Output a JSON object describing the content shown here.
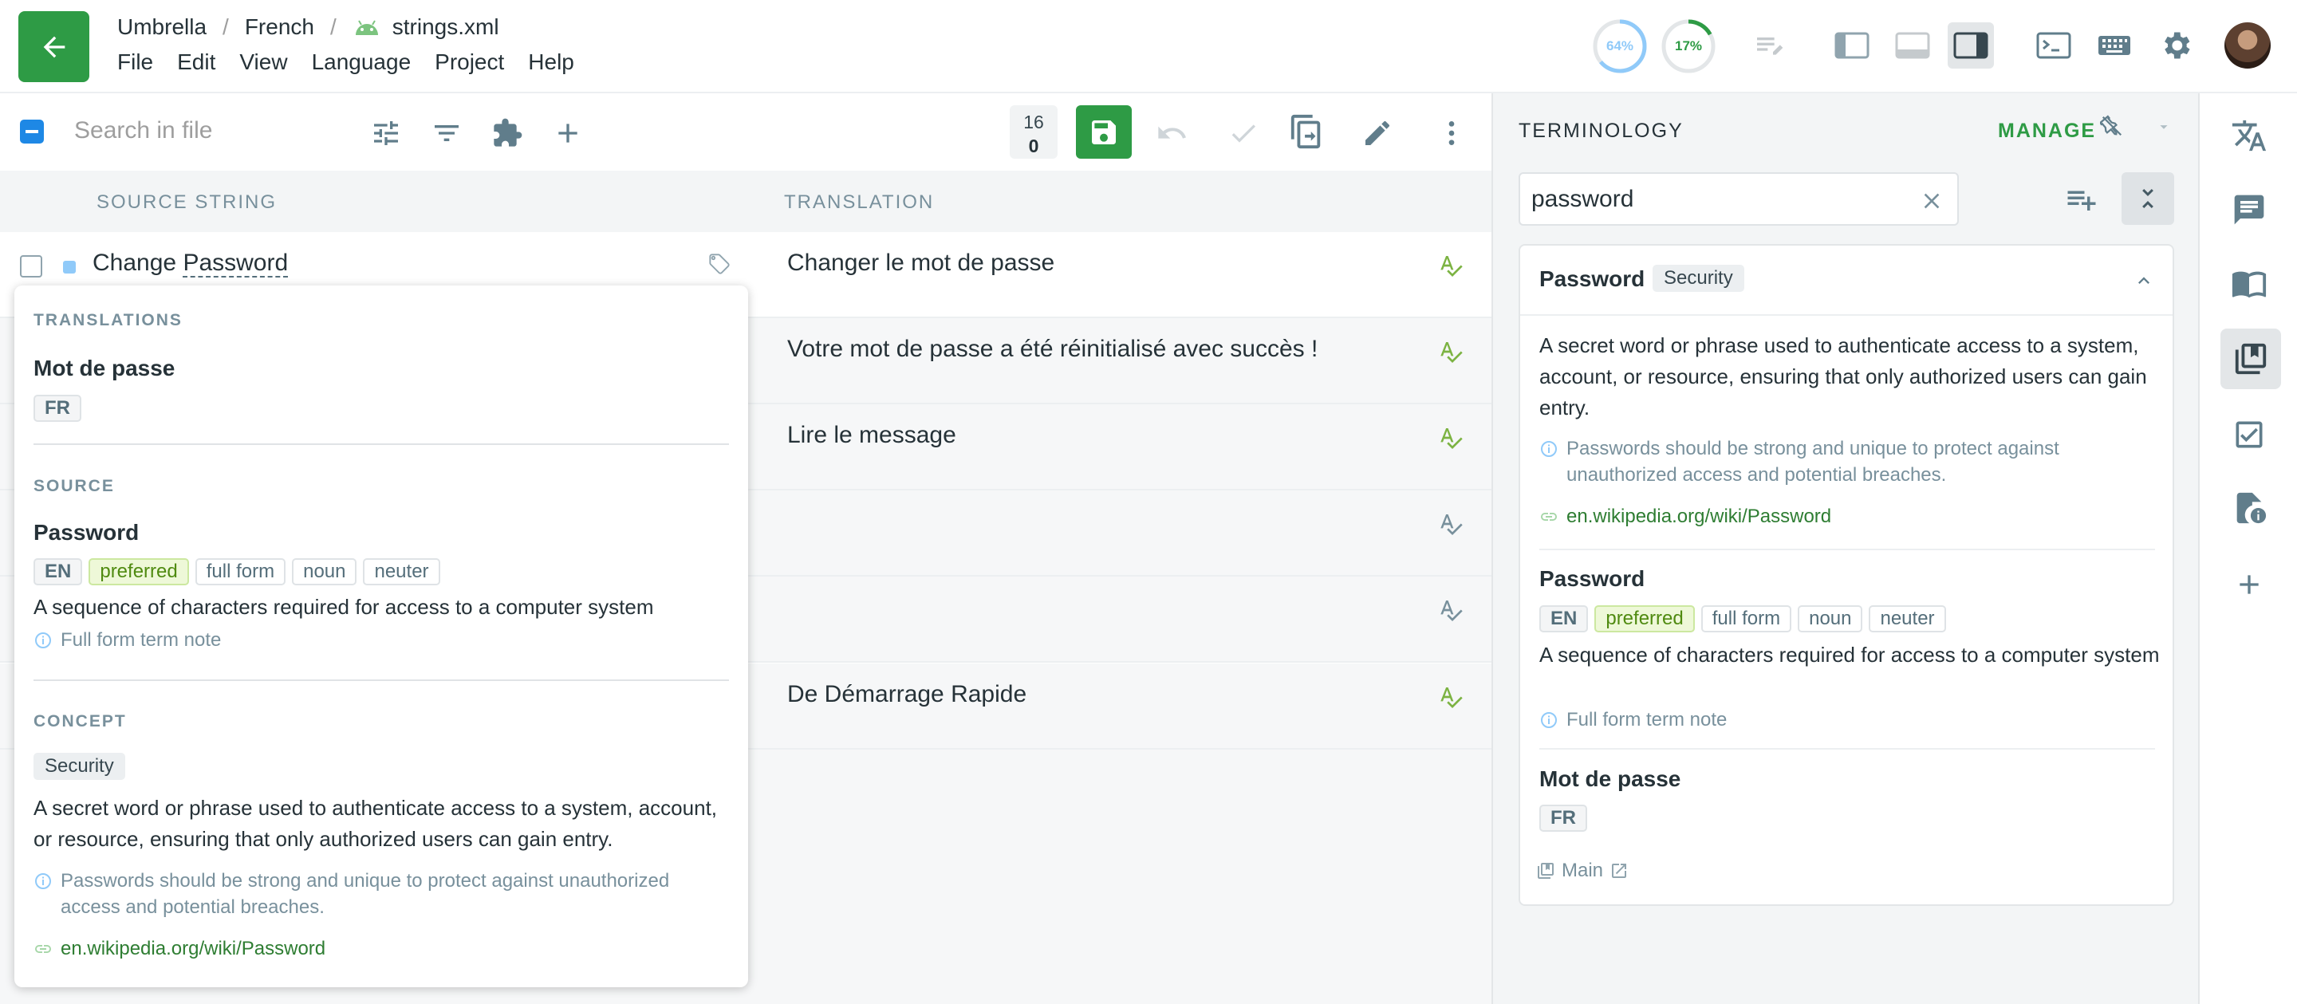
{
  "header": {
    "breadcrumb": {
      "project": "Umbrella",
      "language": "French",
      "file": "strings.xml",
      "separator": "/"
    },
    "menu": [
      "File",
      "Edit",
      "View",
      "Language",
      "Project",
      "Help"
    ],
    "progress": [
      {
        "value": "64%",
        "fraction": 0.64,
        "color": "#90caf9"
      },
      {
        "value": "17%",
        "fraction": 0.17,
        "color": "#2e9b45"
      }
    ]
  },
  "toolbar": {
    "search_placeholder": "Search in file",
    "counter_top": "16",
    "counter_bottom": "0"
  },
  "table": {
    "source_header": "SOURCE STRING",
    "translation_header": "TRANSLATION",
    "rows": [
      {
        "source_prefix": "Change ",
        "source_term": "Password",
        "translation": "Changer le mot de passe"
      },
      {
        "translation": "Votre mot de passe a été réinitialisé avec succès !"
      },
      {
        "translation": "Lire le message"
      },
      {
        "translation": ""
      },
      {
        "translation": ""
      },
      {
        "translation": "De Démarrage Rapide"
      }
    ]
  },
  "popover": {
    "translations_label": "TRANSLATIONS",
    "translation_term": "Mot de passe",
    "translation_lang": "FR",
    "source_label": "SOURCE",
    "source_term": "Password",
    "source_chips": [
      "EN",
      "preferred",
      "full form",
      "noun",
      "neuter"
    ],
    "source_definition": "A sequence of characters required for access to a computer system",
    "source_note": "Full form term note",
    "concept_label": "CONCEPT",
    "concept_chip": "Security",
    "concept_definition": "A secret word or phrase used to authenticate access to a system, account, or resource, ensuring that only authorized users can gain entry.",
    "concept_note": "Passwords should be strong and unique to protect against unauthorized access and potential breaches.",
    "concept_link": "en.wikipedia.org/wiki/Password"
  },
  "terminology": {
    "title": "TERMINOLOGY",
    "manage": "MANAGE",
    "search_value": "password",
    "card": {
      "name": "Password",
      "chip": "Security",
      "definition": "A secret word or phrase used to authenticate access to a system, account, or resource, ensuring that only authorized users can gain entry.",
      "note": "Passwords should be strong and unique to protect against unauthorized access and potential breaches.",
      "link": "en.wikipedia.org/wiki/Password",
      "term1": "Password",
      "term1_chips": [
        "EN",
        "preferred",
        "full form",
        "noun",
        "neuter"
      ],
      "term1_definition": "A sequence of characters required for access to a computer system",
      "term1_note": "Full form term note",
      "term2": "Mot de passe",
      "term2_lang": "FR",
      "glossary": "Main"
    }
  },
  "colors": {
    "accent": "#2e9b45",
    "selection": "#1e88e5",
    "panel_bg": "#f3f5f6"
  }
}
